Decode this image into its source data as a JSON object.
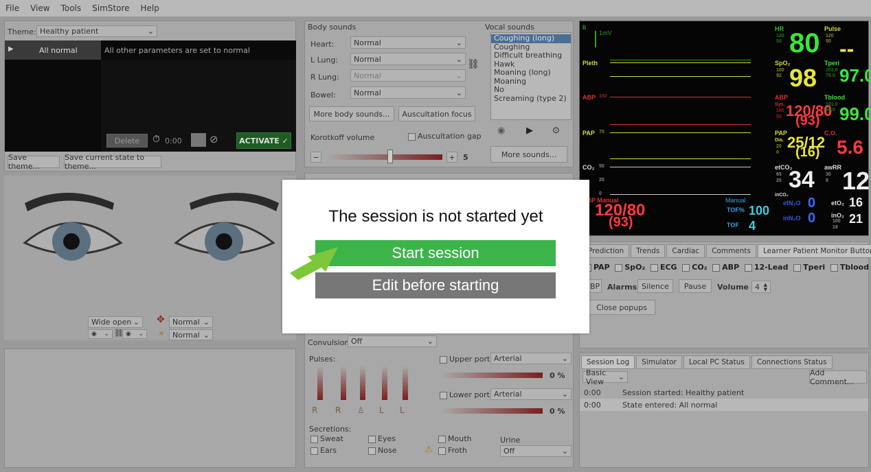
{
  "menu": [
    "File",
    "View",
    "Tools",
    "SimStore",
    "Help"
  ],
  "theme": {
    "label": "Theme:",
    "value": "Healthy patient",
    "state_name": "All normal",
    "state_desc": "All other parameters are set to normal",
    "delete": "Delete",
    "timer": "0:00",
    "activate": "ACTIVATE ✓",
    "save_theme": "Save theme...",
    "save_state": "Save current state to theme..."
  },
  "body_sounds": {
    "title": "Body sounds",
    "rows": [
      {
        "label": "Heart:",
        "value": "Normal"
      },
      {
        "label": "L Lung:",
        "value": "Normal"
      },
      {
        "label": "R Lung:",
        "value": "Normal"
      },
      {
        "label": "Bowel:",
        "value": "Normal"
      }
    ],
    "more_body": "More body sounds...",
    "ausc_focus": "Auscultation focus",
    "korotkoff": "Korotkoff volume",
    "ausc_gap": "Auscultation gap",
    "minus": "−",
    "plus": "+",
    "volume": "5"
  },
  "vocal_sounds": {
    "title": "Vocal sounds",
    "items": [
      "Coughing (long)",
      "Coughing",
      "Difficult breathing",
      "Hawk",
      "Moaning (long)",
      "Moaning",
      "No",
      "Screaming (type 2)"
    ],
    "selected": "Coughing (long)",
    "more": "More sounds..."
  },
  "monitor": {
    "lead": "II",
    "mv": "1mV",
    "hr": {
      "label": "HR",
      "hi": "120",
      "lo": "50",
      "value": "80"
    },
    "pulse": {
      "label": "Pulse",
      "hi": "120",
      "lo": "50",
      "value": "--"
    },
    "pleth": "Pleth",
    "spo2": {
      "label": "SpO₂",
      "hi": "100",
      "lo": "92",
      "value": "98"
    },
    "tperi": {
      "label": "Tperi",
      "hi": "101.0",
      "lo": "79.0",
      "value": "97.0"
    },
    "abp": {
      "label": "ABP",
      "scale": "150",
      "sys_lbl": "Sys.",
      "hi": "160",
      "lo": "50",
      "value": "120/80",
      "mean": "(93)"
    },
    "tblood": {
      "label": "Tblood",
      "hi": "101.0",
      "lo": "96.0",
      "value": "99.0"
    },
    "pap": {
      "label": "PAP",
      "scale": "70",
      "dia_lbl": "Dia.",
      "hi": "20",
      "lo": "0",
      "value": "25/12",
      "mean": "(16)"
    },
    "co": {
      "label": "C.O.",
      "value": "5.6"
    },
    "co2": {
      "label": "CO₂",
      "scale": "50",
      "mid": "25",
      "zero": "0"
    },
    "etco2": {
      "label": "etCO₂",
      "hi": "65",
      "lo": "25",
      "value": "34"
    },
    "awrr": {
      "label": "awRR",
      "hi": "30",
      "lo": "8",
      "value": "12"
    },
    "inco2": "inCO₂",
    "nbp": {
      "label": "NBP Manual",
      "value": "120/80",
      "mean": "(93)"
    },
    "manual": "Manual",
    "tof_pct": {
      "label": "TOF%",
      "value": "100"
    },
    "tof": {
      "label": "TOF",
      "value": "4"
    },
    "etn2o": {
      "label": "etN₂O",
      "value": "0"
    },
    "inn2o": {
      "label": "inN₂O",
      "value": "0"
    },
    "eto2": {
      "label": "etO₂",
      "value": "16"
    },
    "ino2": {
      "label": "inO₂",
      "hi": "100",
      "lo": "18",
      "value": "21"
    }
  },
  "tabs_right": [
    "Prediction",
    "Trends",
    "Cardiac",
    "Comments",
    "Learner Patient Monitor Buttons"
  ],
  "monitor_buttons": {
    "checks": [
      "PAP",
      "SpO₂",
      "ECG",
      "CO₂",
      "ABP",
      "12-Lead",
      "Tperi",
      "Tblood"
    ],
    "nbp": "NBP",
    "alarms": "Alarms:",
    "silence": "Silence",
    "pause": "Pause",
    "volume_lbl": "Volume",
    "volume": "4",
    "close_popups": "Close popups"
  },
  "eyes": {
    "lid": "Wide open",
    "pupil": "Normal",
    "pupil2": "Normal"
  },
  "physio": {
    "convulsions_lbl": "Convulsions:",
    "convulsions": "Off",
    "pulses": "Pulses:",
    "upper_port": "Upper port",
    "upper_val": "Arterial",
    "upper_pct": "0 %",
    "lower_port": "Lower port",
    "lower_val": "Arterial",
    "lower_pct": "0 %",
    "secretions": "Secretions:",
    "sweat": "Sweat",
    "eyes": "Eyes",
    "mouth": "Mouth",
    "ears": "Ears",
    "nose": "Nose",
    "froth": "Froth",
    "urine": "Urine",
    "urine_val": "Off"
  },
  "log": {
    "tabs": [
      "Session Log",
      "Simulator",
      "Local PC Status",
      "Connections Status"
    ],
    "view": "Basic View",
    "add": "Add Comment...",
    "entries": [
      {
        "time": "0:00",
        "text": "Session started: Healthy patient"
      },
      {
        "time": "0:00",
        "text": "State entered: All normal"
      }
    ]
  },
  "overlay": {
    "title": "The session is not started yet",
    "start": "Start session",
    "edit": "Edit before starting"
  }
}
